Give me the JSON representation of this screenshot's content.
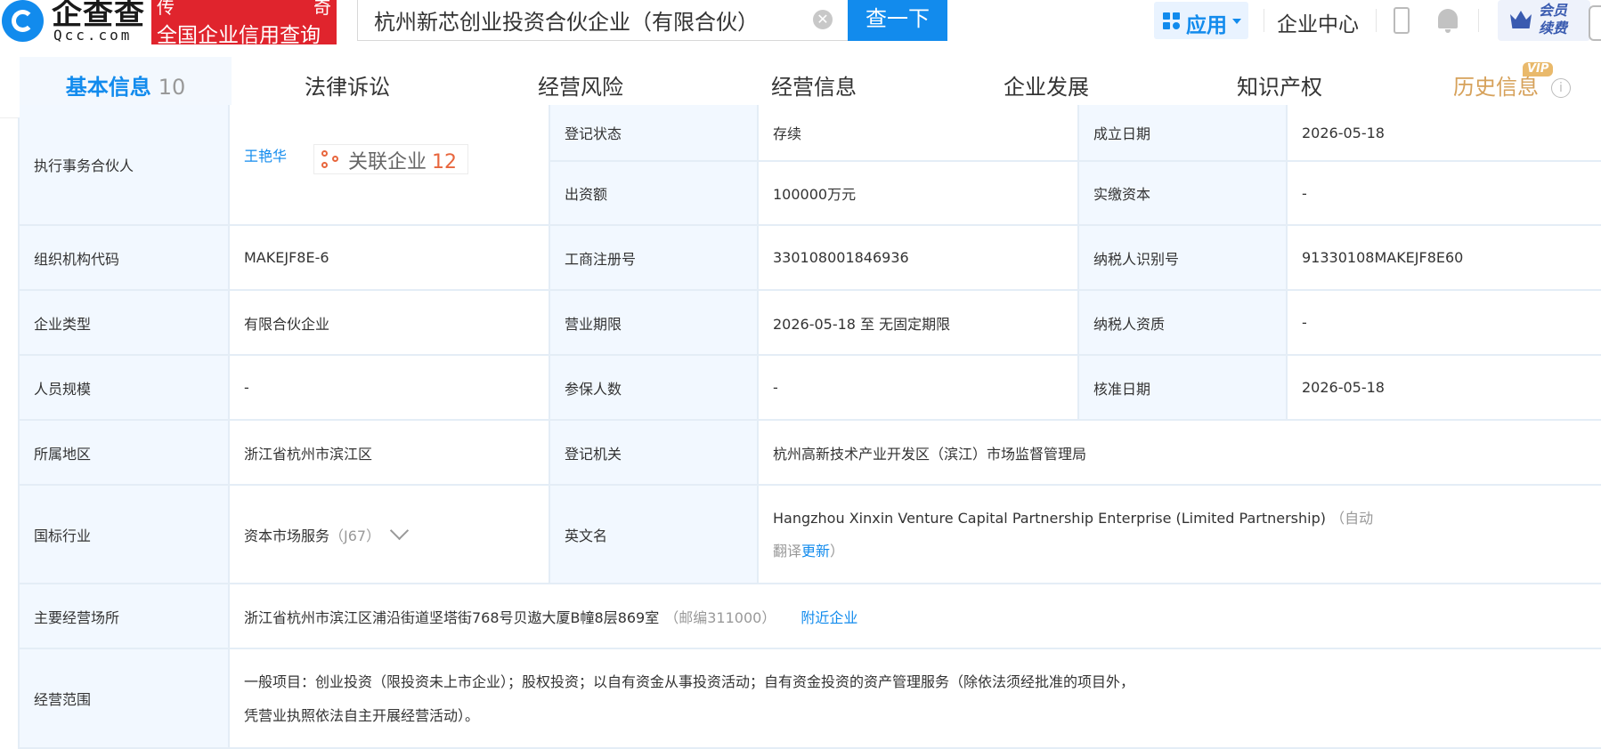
{
  "header": {
    "logo_cn": "企查查",
    "logo_en": "Qcc.com",
    "slogan_top_left": "传",
    "slogan_top_right": "奇",
    "slogan_bottom": "全国企业信用查询",
    "search_value": "杭州新芯创业投资合伙企业（有限合伙）",
    "search_button": "查一下",
    "app_label": "应用",
    "enterprise_center": "企业中心",
    "vip_label": "会员续费"
  },
  "tabs": [
    {
      "label": "基本信息",
      "count": "10",
      "active": true
    },
    {
      "label": "法律诉讼"
    },
    {
      "label": "经营风险"
    },
    {
      "label": "经营信息"
    },
    {
      "label": "企业发展"
    },
    {
      "label": "知识产权"
    },
    {
      "label": "历史信息",
      "tag": "VIP"
    }
  ],
  "info": {
    "partner_label": "执行事务合伙人",
    "partner_name": "王艳华",
    "related_label": "关联企业",
    "related_count": "12",
    "reg_status_label": "登记状态",
    "reg_status": "存续",
    "found_date_label": "成立日期",
    "found_date": "2026-05-18",
    "capital_label": "出资额",
    "capital": "100000万元",
    "paid_capital_label": "实缴资本",
    "paid_capital": "-",
    "org_code_label": "组织机构代码",
    "org_code": "MAKEJF8E-6",
    "biz_reg_label": "工商注册号",
    "biz_reg": "330108001846936",
    "tax_id_label": "纳税人识别号",
    "tax_id": "91330108MAKEJF8E60",
    "ent_type_label": "企业类型",
    "ent_type": "有限合伙企业",
    "biz_term_label": "营业期限",
    "biz_term": "2026-05-18 至 无固定期限",
    "tax_qual_label": "纳税人资质",
    "tax_qual": "-",
    "staff_label": "人员规模",
    "staff": "-",
    "insured_label": "参保人数",
    "insured": "-",
    "approve_label": "核准日期",
    "approve_date": "2026-05-18",
    "region_label": "所属地区",
    "region": "浙江省杭州市滨江区",
    "authority_label": "登记机关",
    "authority": "杭州高新技术产业开发区（滨江）市场监督管理局",
    "industry_label": "国标行业",
    "industry": "资本市场服务",
    "industry_code": "（J67）",
    "en_name_label": "英文名",
    "en_name": "Hangzhou Xinxin Venture Capital Partnership Enterprise (Limited Partnership)",
    "en_name_note_1": "（自动",
    "en_name_note_2": "翻译",
    "en_name_update": "更新",
    "en_name_note_3": "）",
    "address_label": "主要经营场所",
    "address": "浙江省杭州市滨江区浦沿街道坚塔街768号贝遨大厦B幢8层869室",
    "postcode": "（邮编311000）",
    "nearby": "附近企业",
    "scope_label": "经营范围",
    "scope_line1": "一般项目：创业投资（限投资未上市企业）；股权投资；以自有资金从事投资活动；自有资金投资的资产管理服务（除依法须经批准的项目外，",
    "scope_line2": "凭营业执照依法自主开展经营活动）。"
  },
  "colors": {
    "brand_blue": "#128bed",
    "brand_red": "#e0242d",
    "label_bg": "#f2f8ff",
    "border": "#e4edf6",
    "history_gold": "#d6a15a",
    "related_orange": "#e8663d"
  }
}
